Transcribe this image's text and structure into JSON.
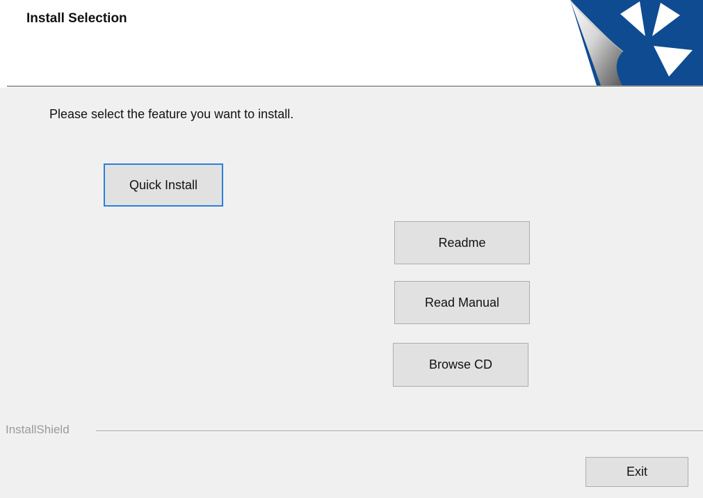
{
  "header": {
    "title": "Install Selection"
  },
  "main": {
    "prompt": "Please select the feature you want to install.",
    "buttons": {
      "quick_install": "Quick Install",
      "readme": "Readme",
      "read_manual": "Read Manual",
      "browse_cd": "Browse CD"
    }
  },
  "footer": {
    "brand": "InstallShield",
    "exit_label": "Exit"
  },
  "colors": {
    "logo_blue": "#0f4b91",
    "focus_border": "#2b7fdb",
    "button_face": "#e1e1e1",
    "dialog_bg": "#f0f0f0"
  },
  "icons": {
    "logo": "installshield-logo-icon"
  }
}
